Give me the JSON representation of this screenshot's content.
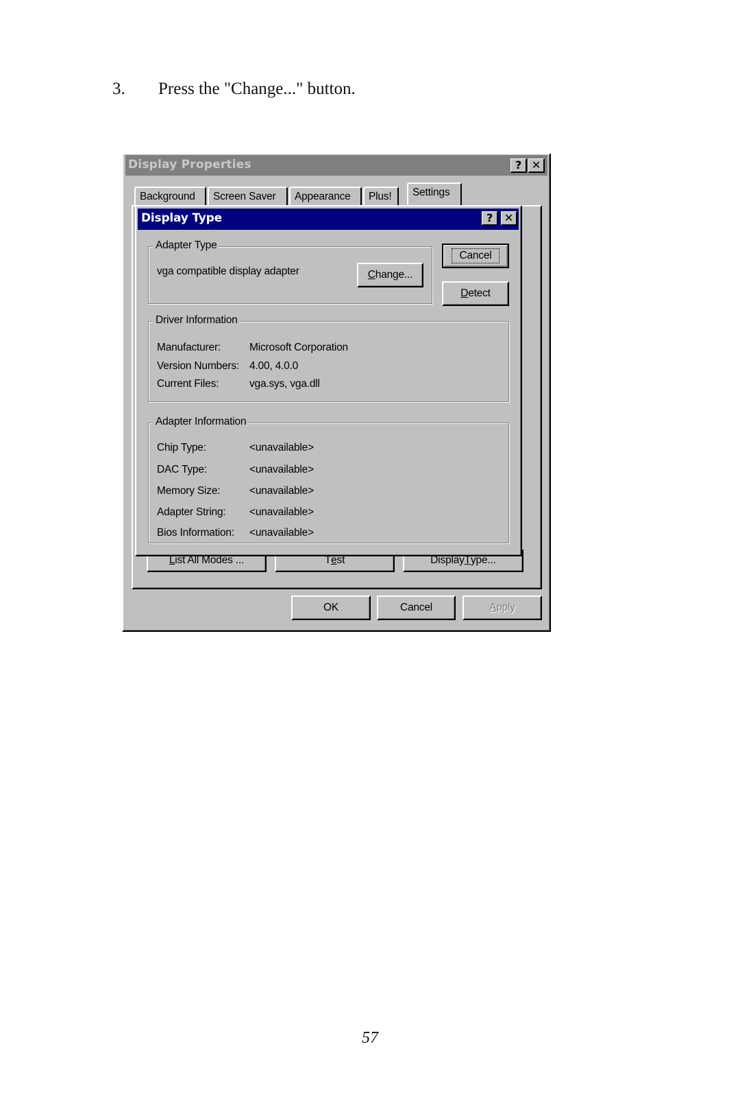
{
  "document": {
    "step_number": "3.",
    "step_text": "Press the \"Change...\" button.",
    "page_number": "57"
  },
  "display_properties": {
    "title": "Display Properties",
    "help_icon": "?",
    "close_icon": "✕",
    "tabs": [
      {
        "label": "Background",
        "selected": false
      },
      {
        "label": "Screen Saver",
        "selected": false
      },
      {
        "label": "Appearance",
        "selected": false
      },
      {
        "label": "Plus!",
        "selected": false
      },
      {
        "label": "Settings",
        "selected": true
      }
    ],
    "settings_buttons": {
      "list_all_modes": {
        "pre": "",
        "mnemonic": "L",
        "post": "ist All Modes ..."
      },
      "test": {
        "pre": "T",
        "mnemonic": "e",
        "post": "st"
      },
      "display_type": {
        "pre": "Display ",
        "mnemonic": "T",
        "post": "ype..."
      }
    },
    "footer_buttons": {
      "ok": "OK",
      "cancel": "Cancel",
      "apply": {
        "pre": "",
        "mnemonic": "A",
        "post": "pply",
        "disabled": true
      }
    }
  },
  "display_type_dialog": {
    "title": "Display Type",
    "help_icon": "?",
    "close_icon": "✕",
    "cancel_button": "Cancel",
    "detect_button": {
      "pre": "",
      "mnemonic": "D",
      "post": "etect"
    },
    "adapter_type": {
      "legend": "Adapter Type",
      "value": "vga compatible display adapter",
      "change_button": {
        "pre": "",
        "mnemonic": "C",
        "post": "hange..."
      }
    },
    "driver_information": {
      "legend": "Driver Information",
      "rows": [
        {
          "label": "Manufacturer:",
          "value": "Microsoft Corporation"
        },
        {
          "label": "Version Numbers:",
          "value": "4.00, 4.0.0"
        },
        {
          "label": "Current Files:",
          "value": "vga.sys, vga.dll"
        }
      ]
    },
    "adapter_information": {
      "legend": "Adapter Information",
      "rows": [
        {
          "label": "Chip Type:",
          "value": "<unavailable>"
        },
        {
          "label": "DAC Type:",
          "value": "<unavailable>"
        },
        {
          "label": "Memory Size:",
          "value": "<unavailable>"
        },
        {
          "label": "Adapter String:",
          "value": "<unavailable>"
        },
        {
          "label": "Bios Information:",
          "value": "<unavailable>"
        }
      ]
    }
  },
  "colors": {
    "dialog_face": "#c0c0c0",
    "active_title": "#000080",
    "inactive_title": "#808080"
  }
}
